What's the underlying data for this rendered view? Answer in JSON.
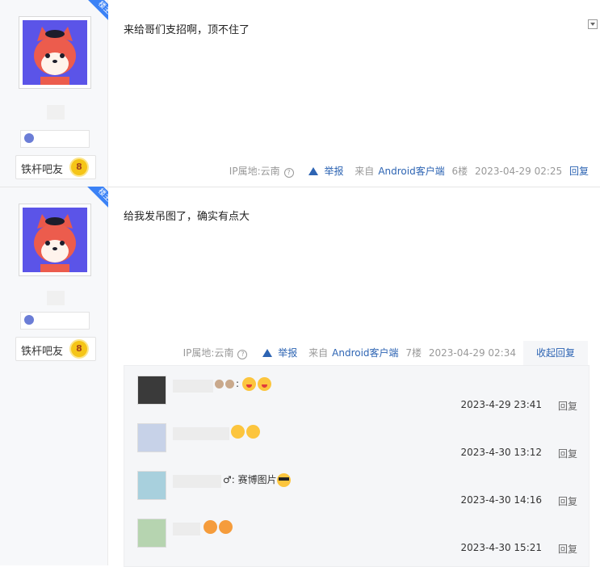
{
  "posts": [
    {
      "floor_badge": "楼主",
      "badge_name": "铁杆吧友",
      "badge_level": "8",
      "content": "来给哥们支招啊，顶不住了",
      "meta": {
        "ip": "IP属地:云南",
        "report": "举报",
        "source_prefix": "来自",
        "source": "Android客户端",
        "floor": "6楼",
        "time": "2023-04-29 02:25",
        "reply": "回复"
      }
    },
    {
      "floor_badge": "楼主",
      "badge_name": "铁杆吧友",
      "badge_level": "8",
      "content": "给我发吊图了，确实有点大",
      "meta": {
        "ip": "IP属地:云南",
        "report": "举报",
        "source_prefix": "来自",
        "source": "Android客户端",
        "floor": "7楼",
        "time": "2023-04-29 02:34",
        "collapse": "收起回复"
      },
      "comments": [
        {
          "text": ":",
          "time": "2023-4-29 23:41",
          "reply": "回复"
        },
        {
          "text": "",
          "time": "2023-4-30 13:12",
          "reply": "回复"
        },
        {
          "text": "♂: 赛博图片",
          "time": "2023-4-30 14:16",
          "reply": "回复"
        },
        {
          "text": "",
          "time": "2023-4-30 15:21",
          "reply": "回复"
        }
      ]
    }
  ],
  "colors": {
    "link": "#2d64b3",
    "sidebar_bg": "#f7f8fa",
    "louzhu_badge": "#3b82f6",
    "avatar_bg": "#5b54e8"
  }
}
